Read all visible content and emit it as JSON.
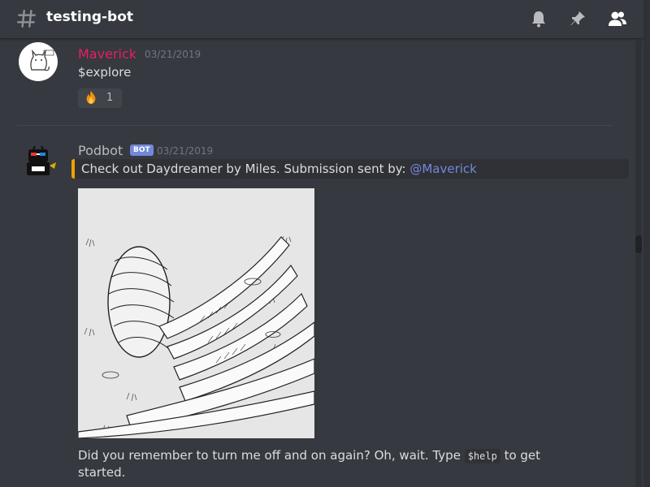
{
  "header": {
    "channel_name": "testing-bot",
    "icons": [
      "hashtag-icon",
      "bell-icon",
      "pin-icon",
      "members-icon"
    ]
  },
  "messages": [
    {
      "author": "Maverick",
      "author_color": "#e91e63",
      "timestamp": "03/21/2019",
      "text": "$explore",
      "reaction": {
        "emoji": "fire-icon",
        "count": "1"
      }
    },
    {
      "author": "Podbot",
      "badge": "BOT",
      "timestamp": "03/21/2019",
      "embed": {
        "prefix": "Check out Daydreamer by Miles. Submission sent by: ",
        "mention": "@Maverick",
        "accent": "#f0a100"
      },
      "image_alt": "Daydreamer",
      "text_before": "Did you remember to turn me off and on again? Oh, wait. Type ",
      "code": "$help",
      "text_after": " to get",
      "text_line2": "started."
    }
  ]
}
